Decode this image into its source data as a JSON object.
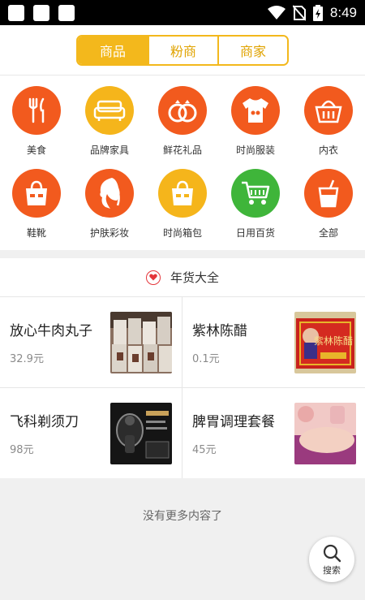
{
  "status_bar": {
    "time": "8:49"
  },
  "tabs": [
    {
      "label": "商品",
      "active": true
    },
    {
      "label": "粉商",
      "active": false
    },
    {
      "label": "商家",
      "active": false
    }
  ],
  "categories": [
    {
      "label": "美食",
      "icon": "fork-knife-icon",
      "color": "#f25a1e"
    },
    {
      "label": "品牌家具",
      "icon": "sofa-icon",
      "color": "#f5b51b"
    },
    {
      "label": "鲜花礼品",
      "icon": "rings-icon",
      "color": "#f25a1e"
    },
    {
      "label": "时尚服装",
      "icon": "tshirt-icon",
      "color": "#f25a1e"
    },
    {
      "label": "内衣",
      "icon": "basket-icon",
      "color": "#f25a1e"
    },
    {
      "label": "鞋靴",
      "icon": "bag-icon",
      "color": "#f25a1e"
    },
    {
      "label": "护肤彩妆",
      "icon": "face-icon",
      "color": "#f25a1e"
    },
    {
      "label": "时尚箱包",
      "icon": "handbag-icon",
      "color": "#f5b51b"
    },
    {
      "label": "日用百货",
      "icon": "cart-icon",
      "color": "#3fb53a"
    },
    {
      "label": "全部",
      "icon": "cup-icon",
      "color": "#f25a1e"
    }
  ],
  "section": {
    "title": "年货大全"
  },
  "products": [
    {
      "name": "放心牛肉丸子",
      "price": "32.9元"
    },
    {
      "name": "紫林陈醋",
      "price": "0.1元",
      "image_text": "紫林陈醋"
    },
    {
      "name": "飞科剃须刀",
      "price": "98元"
    },
    {
      "name": "脾胃调理套餐",
      "price": "45元"
    }
  ],
  "footer": {
    "no_more": "没有更多内容了"
  },
  "search_fab": {
    "label": "搜索"
  },
  "colors": {
    "accent": "#f3b81c",
    "orange": "#f25a1e",
    "green": "#3fb53a"
  }
}
